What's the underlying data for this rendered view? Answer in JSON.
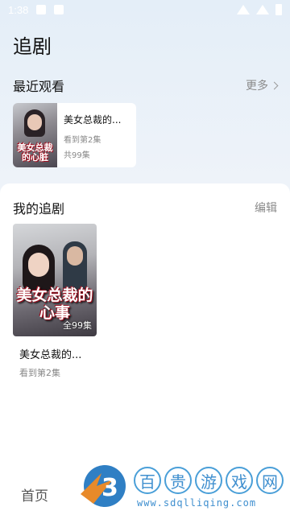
{
  "status_bar": {
    "time": "1:38"
  },
  "page_title": "追剧",
  "recent": {
    "title": "最近观看",
    "more_label": "更多",
    "item": {
      "name": "美女总裁的...",
      "progress": "看到第2集",
      "total": "共99集",
      "poster_text": "美女总裁的心脏"
    }
  },
  "my_list": {
    "title": "我的追剧",
    "edit_label": "编辑",
    "items": [
      {
        "name": "美女总裁的...",
        "progress": "看到第2集",
        "episodes_badge": "全99集",
        "poster_text": "美女总裁的心事"
      }
    ]
  },
  "bottom_nav": {
    "home_label": "首页"
  },
  "watermark": {
    "chars": [
      "百",
      "贵",
      "游",
      "戏",
      "网"
    ],
    "url": "www.sdqlliqing.com"
  },
  "colors": {
    "accent": "#3f8fcf",
    "muted": "#888888",
    "background": "#eef3f9"
  }
}
